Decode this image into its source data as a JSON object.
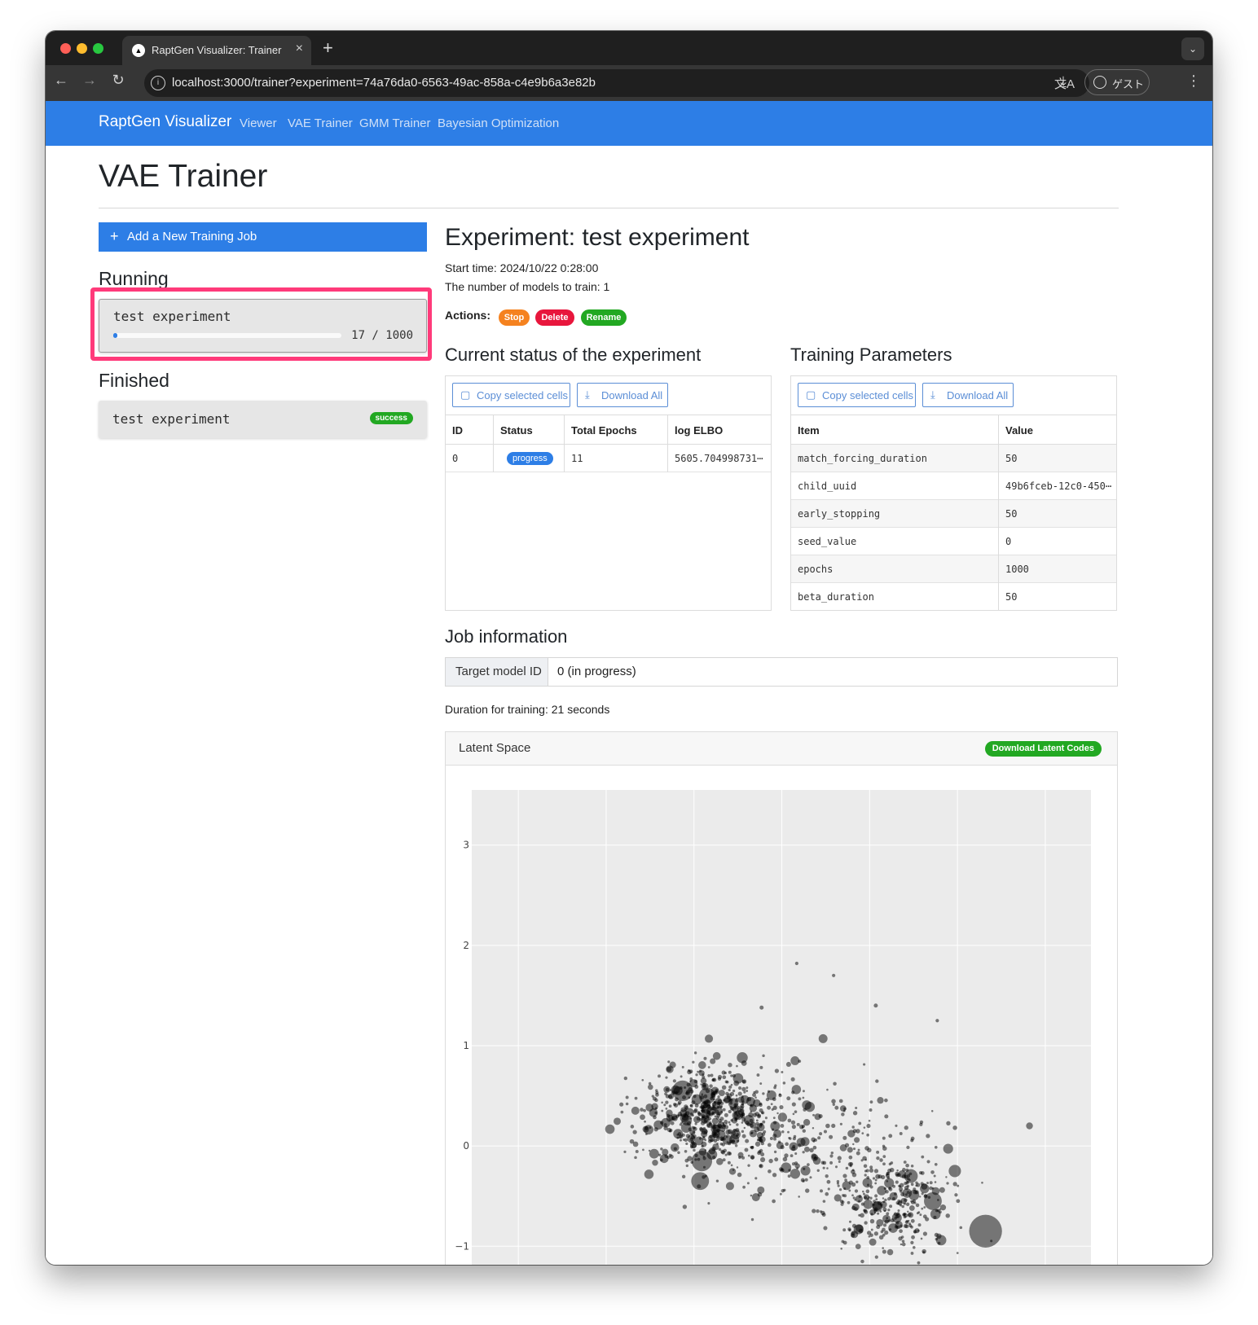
{
  "browser": {
    "tab_title": "RaptGen Visualizer: Trainer",
    "url": "localhost:3000/trainer?experiment=74a76da0-6563-49ac-858a-c4e9b6a3e82b",
    "profile_label": "ゲスト"
  },
  "navbar": {
    "brand": "RaptGen Visualizer",
    "links": [
      "Viewer",
      "VAE Trainer",
      "GMM Trainer",
      "Bayesian Optimization"
    ]
  },
  "page": {
    "title": "VAE Trainer"
  },
  "sidebar": {
    "add_job_label": "Add a New Training Job",
    "running_heading": "Running",
    "running_jobs": [
      {
        "name": "test experiment",
        "current": 17,
        "total": 1000,
        "progress_text": "17 / 1000",
        "progress_fraction": 0.017
      }
    ],
    "finished_heading": "Finished",
    "finished_jobs": [
      {
        "name": "test experiment",
        "status": "success"
      }
    ]
  },
  "experiment": {
    "title": "Experiment: test experiment",
    "start_time": "Start time: 2024/10/22 0:28:00",
    "num_models": "The number of models to train: 1",
    "actions_label": "Actions:",
    "actions": [
      {
        "label": "Stop",
        "color": "#f5821f"
      },
      {
        "label": "Delete",
        "color": "#e8163c"
      },
      {
        "label": "Rename",
        "color": "#22a822"
      }
    ]
  },
  "status_table": {
    "heading": "Current status of the experiment",
    "copy_label": "Copy selected cells",
    "download_label": "Download All",
    "columns": [
      "ID",
      "Status",
      "Total Epochs",
      "log ELBO"
    ],
    "rows": [
      {
        "id": "0",
        "status": "progress",
        "total_epochs": "11",
        "log_elbo": "5605.704998731⋯"
      }
    ]
  },
  "params_table": {
    "heading": "Training Parameters",
    "copy_label": "Copy selected cells",
    "download_label": "Download All",
    "columns": [
      "Item",
      "Value"
    ],
    "rows": [
      {
        "item": "match_forcing_duration",
        "value": "50"
      },
      {
        "item": "child_uuid",
        "value": "49b6fceb-12c0-450⋯"
      },
      {
        "item": "early_stopping",
        "value": "50"
      },
      {
        "item": "seed_value",
        "value": "0"
      },
      {
        "item": "epochs",
        "value": "1000"
      },
      {
        "item": "beta_duration",
        "value": "50"
      }
    ]
  },
  "job_info": {
    "heading": "Job information",
    "target_label": "Target model ID",
    "target_value": "0 (in progress)",
    "duration": "Duration for training: 21 seconds"
  },
  "latent_space": {
    "title": "Latent Space",
    "download_label": "Download Latent Codes"
  },
  "chart_data": {
    "type": "scatter",
    "title": "",
    "xlabel": "",
    "ylabel": "",
    "ylim": [
      -1.55,
      3.55
    ],
    "xlim": [
      -3.3,
      3.75
    ],
    "yticks": [
      "3",
      "2",
      "1",
      "0",
      "−1"
    ],
    "ytick_values": [
      3,
      2,
      1,
      0,
      -1
    ],
    "x_grid_values": [
      -2.77,
      -1.77,
      -0.77,
      0.23,
      1.23,
      2.23,
      3.23
    ],
    "grid": true,
    "marker_color": "#000000",
    "marker_opacity": 0.5,
    "clusters": [
      {
        "cx": -0.6,
        "cy": 0.3,
        "sx": 0.55,
        "sy": 0.35,
        "n": 520
      },
      {
        "cx": 1.5,
        "cy": -0.6,
        "sx": 0.5,
        "sy": 0.35,
        "n": 300
      },
      {
        "cx": 0.5,
        "cy": 0.05,
        "sx": 0.9,
        "sy": 0.45,
        "n": 280
      }
    ],
    "points": [
      {
        "x": 2.55,
        "y": -0.85,
        "size": 4.8
      },
      {
        "x": -0.9,
        "y": 0.55,
        "size": 3.0
      },
      {
        "x": -0.62,
        "y": 0.5,
        "size": 2.4
      },
      {
        "x": -0.68,
        "y": -0.15,
        "size": 3.0
      },
      {
        "x": -0.7,
        "y": -0.35,
        "size": 2.6
      },
      {
        "x": 1.95,
        "y": -0.55,
        "size": 2.6
      },
      {
        "x": 1.7,
        "y": -0.3,
        "size": 2.0
      },
      {
        "x": 2.2,
        "y": -0.25,
        "size": 1.8
      },
      {
        "x": 0.7,
        "y": 1.07,
        "size": 1.3
      },
      {
        "x": -0.98,
        "y": 0.56,
        "size": 1.3
      },
      {
        "x": -0.22,
        "y": 0.88,
        "size": 1.6
      },
      {
        "x": -0.6,
        "y": 1.07,
        "size": 1.2
      },
      {
        "x": 0.38,
        "y": 0.85,
        "size": 1.3
      },
      {
        "x": 3.05,
        "y": 0.2,
        "size": 1.0
      },
      {
        "x": -0.36,
        "y": -0.4,
        "size": 1.2
      },
      {
        "x": -0.95,
        "y": 0.55,
        "size": 1.3
      },
      {
        "x": 1.98,
        "y": -0.68,
        "size": 1.5
      },
      {
        "x": 1.6,
        "y": -0.28,
        "size": 1.1
      },
      {
        "x": 0.0,
        "y": 1.38,
        "size": 0.6
      },
      {
        "x": 0.4,
        "y": 1.82,
        "size": 0.5
      },
      {
        "x": 0.82,
        "y": 1.7,
        "size": 0.5
      },
      {
        "x": 1.3,
        "y": 1.4,
        "size": 0.6
      },
      {
        "x": 2.0,
        "y": 1.25,
        "size": 0.5
      }
    ]
  }
}
